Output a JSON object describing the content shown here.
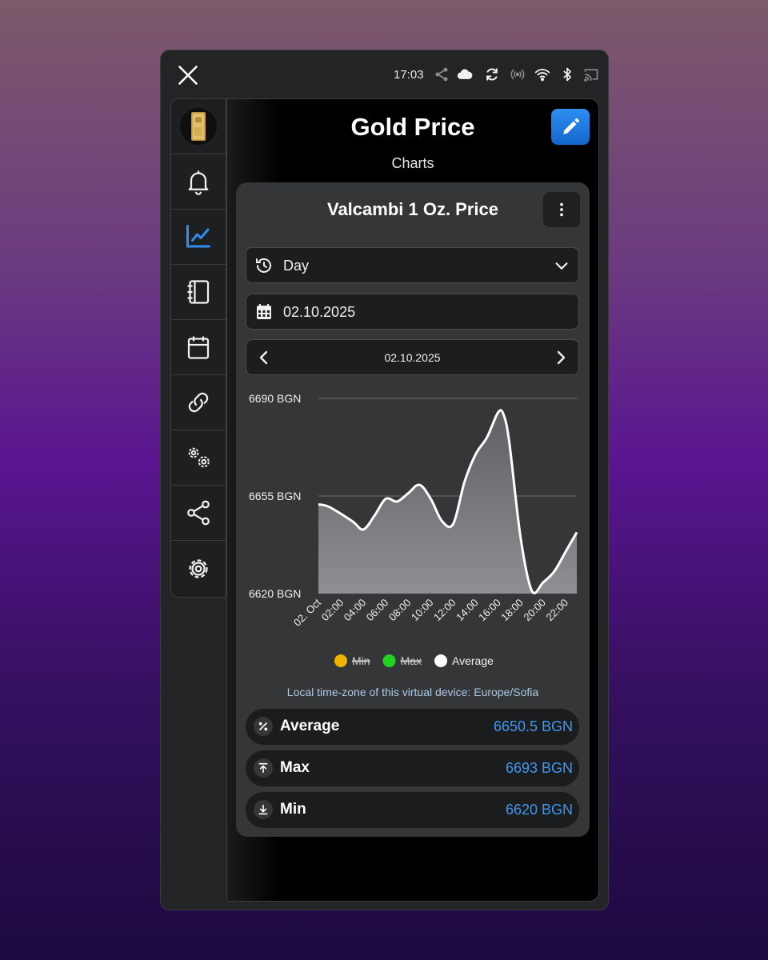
{
  "status_bar": {
    "time": "17:03",
    "icons": [
      "share-icon",
      "cloud-icon",
      "sync-icon",
      "broadcast-icon",
      "wifi-icon",
      "bluetooth-icon",
      "cast-icon"
    ]
  },
  "sidebar": {
    "items": [
      {
        "name": "gold-bar-thumbnail",
        "active": false
      },
      {
        "name": "bell-icon",
        "active": false
      },
      {
        "name": "line-chart-icon",
        "active": true
      },
      {
        "name": "notebook-icon",
        "active": false
      },
      {
        "name": "calendar-icon",
        "active": false
      },
      {
        "name": "link-icon",
        "active": false
      },
      {
        "name": "gears-icon",
        "active": false
      },
      {
        "name": "share-icon",
        "active": false
      },
      {
        "name": "settings-icon",
        "active": false
      }
    ],
    "active_color": "#2f8ef0"
  },
  "header": {
    "title": "Gold Price",
    "subtitle": "Charts"
  },
  "card": {
    "title": "Valcambi 1 Oz. Price",
    "period_select": "Day",
    "date_input": "02.10.2025",
    "nav_date": "02.10.2025",
    "timezone_note": "Local time-zone of this virtual device: Europe/Sofia"
  },
  "stats": [
    {
      "label": "Average",
      "value": "6650.5 BGN",
      "icon": "percent-icon"
    },
    {
      "label": "Max",
      "value": "6693 BGN",
      "icon": "arrow-up-to-line-icon"
    },
    {
      "label": "Min",
      "value": "6620 BGN",
      "icon": "arrow-down-to-line-icon"
    }
  ],
  "chart_data": {
    "type": "area",
    "y_tick_labels": [
      "6690 BGN",
      "6655 BGN",
      "6620 BGN"
    ],
    "y_ticks": [
      6690,
      6655,
      6620
    ],
    "ylim": [
      6620,
      6690
    ],
    "x_tick_labels": [
      "02. Oct",
      "02:00",
      "04:00",
      "06:00",
      "08:00",
      "10:00",
      "12:00",
      "14:00",
      "16:00",
      "18:00",
      "20:00",
      "22:00"
    ],
    "xlim": [
      0,
      23
    ],
    "grid": true,
    "legend_position": "bottom",
    "legend": [
      {
        "name": "Min",
        "color": "#f0b400",
        "hidden": true
      },
      {
        "name": "Max",
        "color": "#22d422",
        "hidden": true
      },
      {
        "name": "Average",
        "color": "#ffffff",
        "hidden": false
      }
    ],
    "series": [
      {
        "name": "Average",
        "x": [
          0,
          1,
          3,
          4,
          5,
          6,
          7,
          8,
          9,
          10,
          11,
          12,
          13,
          14,
          15,
          16,
          16.5,
          17,
          18,
          19,
          20,
          21,
          22,
          23
        ],
        "y": [
          6652,
          6651,
          6646,
          6643,
          6648,
          6654,
          6653,
          6656,
          6659,
          6654,
          6646,
          6645,
          6660,
          6670,
          6676,
          6685,
          6684,
          6674,
          6640,
          6621,
          6624,
          6628,
          6635,
          6642
        ]
      }
    ]
  }
}
